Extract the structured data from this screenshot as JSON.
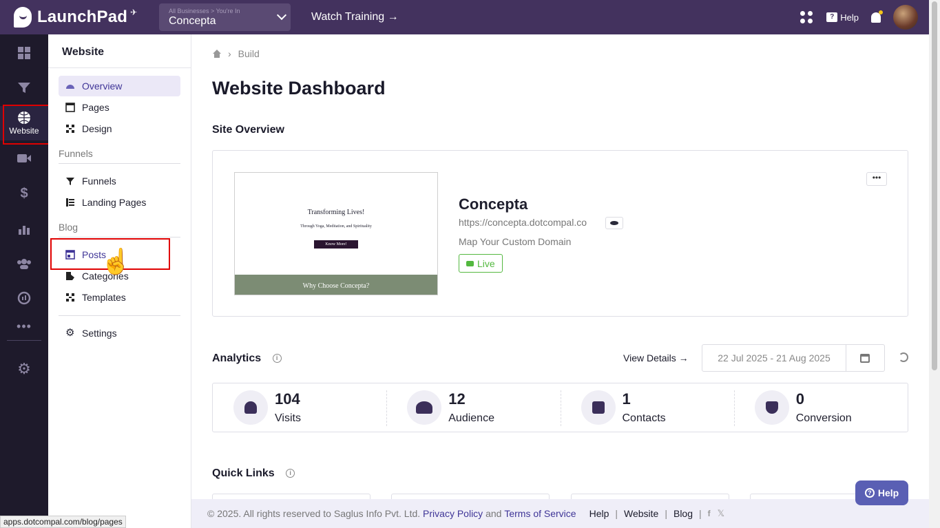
{
  "header": {
    "logo_text": "LaunchPad",
    "business_breadcrumb": "All Businesses > You're In",
    "business_name": "Concepta",
    "watch_training": "Watch Training →",
    "help_label": "Help"
  },
  "rail": {
    "active_label": "Website",
    "icons": [
      "dashboard-icon",
      "funnel-icon",
      "globe-icon",
      "video-icon",
      "dollar-icon",
      "analytics-icon",
      "people-icon",
      "reports-icon",
      "more-icon",
      "gear-icon"
    ]
  },
  "sidebar": {
    "title": "Website",
    "items": [
      {
        "label": "Overview"
      },
      {
        "label": "Pages"
      },
      {
        "label": "Design"
      }
    ],
    "funnels_section": "Funnels",
    "funnel_items": [
      {
        "label": "Funnels"
      },
      {
        "label": "Landing Pages"
      }
    ],
    "blog_section": "Blog",
    "blog_items": [
      {
        "label": "Posts"
      },
      {
        "label": "Categories"
      },
      {
        "label": "Templates"
      }
    ],
    "settings_label": "Settings"
  },
  "status_bar_url": "apps.dotcompal.com/blog/pages",
  "breadcrumb": {
    "current": "Build"
  },
  "page_title": "Website Dashboard",
  "site_overview": {
    "section_title": "Site Overview",
    "thumb_headline": "Transforming Lives!",
    "thumb_subline": "Through Yoga, Meditation, and Spirituality",
    "thumb_button": "Know More!",
    "thumb_bar": "Why Choose Concepta?",
    "site_name": "Concepta",
    "site_url": "https://concepta.dotcompal.co",
    "custom_domain": "Map Your Custom Domain",
    "status": "Live",
    "more_label": "•••"
  },
  "analytics": {
    "title": "Analytics",
    "view_details": "View Details →",
    "date_range": "22 Jul 2025 - 21 Aug 2025",
    "stats": [
      {
        "value": "104",
        "label": "Visits"
      },
      {
        "value": "12",
        "label": "Audience"
      },
      {
        "value": "1",
        "label": "Contacts"
      },
      {
        "value": "0",
        "label": "Conversion"
      }
    ]
  },
  "quick_links": {
    "title": "Quick Links"
  },
  "footer": {
    "copyright": "©  2025. All rights reserved to Saglus Info Pvt. Ltd.",
    "privacy": "Privacy Policy",
    "and": "and",
    "terms": "Terms of Service",
    "links": [
      "Help",
      "Website",
      "Blog"
    ]
  },
  "help_button": "Help",
  "colors": {
    "topbar": "#43325e",
    "rail": "#1e1a2b",
    "accent": "#3f3597",
    "live": "#53b83f",
    "highlight": "#e00000"
  }
}
